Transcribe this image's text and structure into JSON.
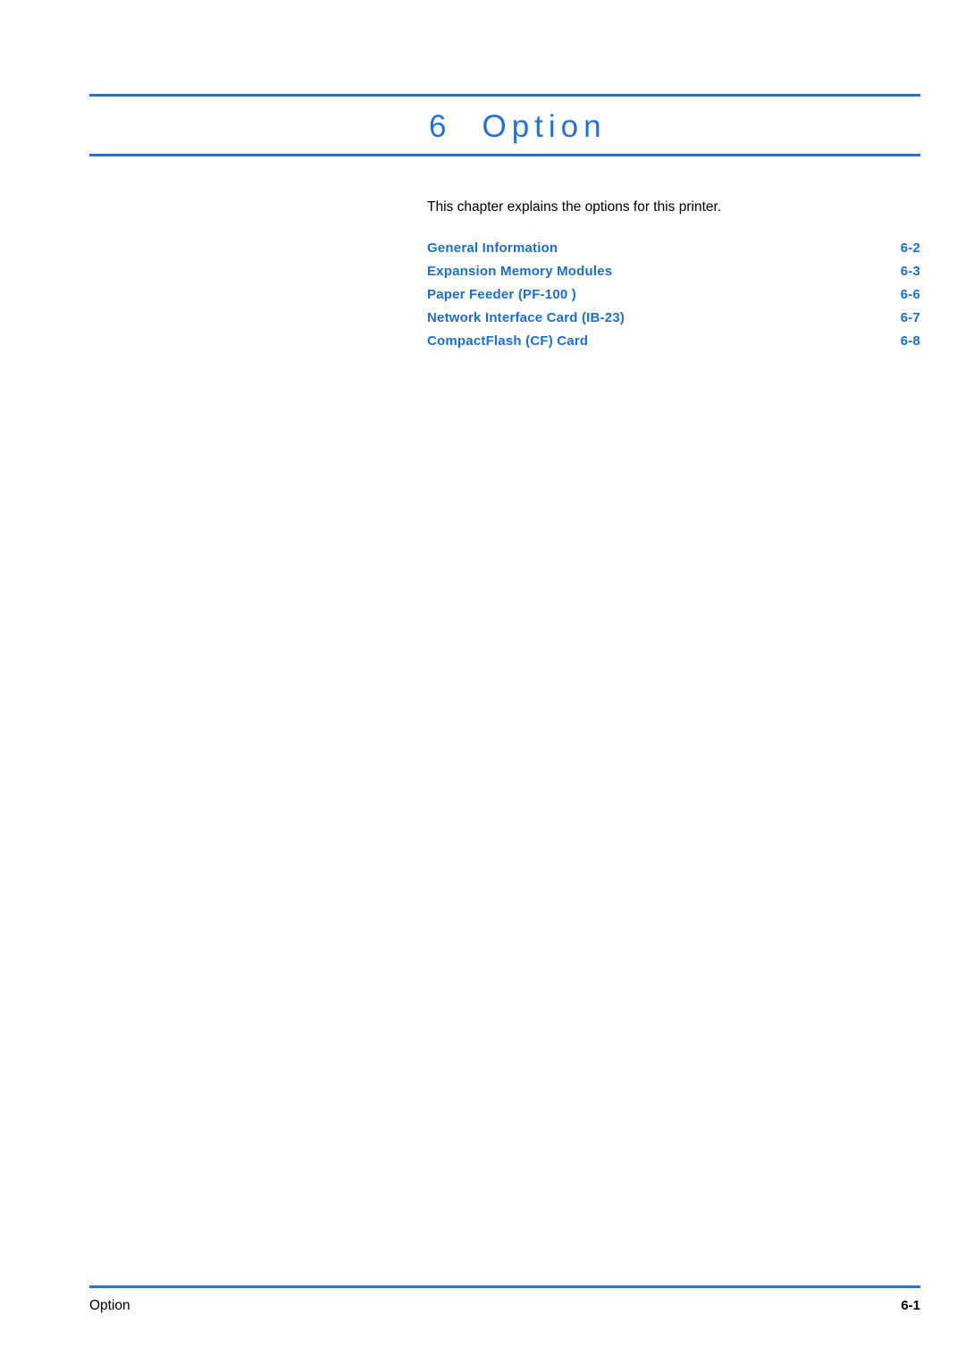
{
  "chapter": {
    "number": "6",
    "title": "Option"
  },
  "intro": "This chapter explains the options for this printer.",
  "toc": {
    "items": [
      {
        "label": "General Information",
        "page": "6-2"
      },
      {
        "label": "Expansion Memory Modules",
        "page": "6-3"
      },
      {
        "label": "Paper Feeder (PF-100 )",
        "page": "6-6"
      },
      {
        "label": "Network Interface Card (IB-23)",
        "page": "6-7"
      },
      {
        "label": "CompactFlash (CF) Card",
        "page": "6-8"
      }
    ]
  },
  "footer": {
    "left": "Option",
    "right": "6-1"
  },
  "colors": {
    "accent": "#2272d4",
    "link": "#1b6fd0"
  }
}
